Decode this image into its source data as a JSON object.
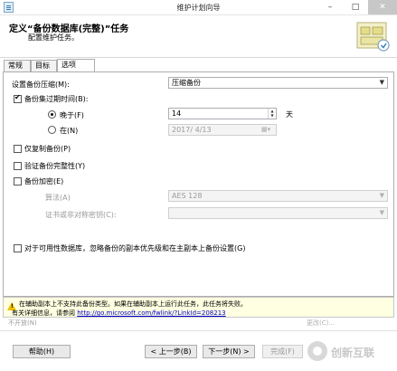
{
  "window": {
    "title": "维护计划向导",
    "min_glyph": "–",
    "max_glyph": "□",
    "close_glyph": "✕"
  },
  "header": {
    "title": "定义“备份数据库(完整)”任务",
    "subtitle": "配置维护任务。"
  },
  "tabs": [
    "常规",
    "目标",
    "选项"
  ],
  "active_tab": "选项",
  "options": {
    "compression_label": "设置备份压缩(M):",
    "compression_value": "压缩备份",
    "expire_label": "备份集过期时间(B):",
    "expire_checked": true,
    "after_label": "晚于(F)",
    "after_selected": true,
    "after_value": "14",
    "days_label": "天",
    "on_label": "在(N)",
    "on_value": "2017/ 4/13",
    "copy_only_label": "仅复制备份(P)",
    "verify_label": "验证备份完整性(Y)",
    "encrypt_label": "备份加密(E)",
    "algorithm_label": "算法(A)",
    "algorithm_value": "AES 128",
    "cert_label": "证书或非对称密钥(C):",
    "cert_value": "",
    "ag_label": "对于可用性数据库，忽略备份的副本优先级和在主副本上备份设置(G)"
  },
  "warning": {
    "line1": "在辅助副本上不支持此备份类型。如果在辅助副本上运行此任务，此任务将失败。",
    "line2_prefix": "有关详细信息，请参阅",
    "link": "http://go.microsoft.com/fwlink/?LinkId=208213"
  },
  "behind_row": {
    "left": "不开放(N)",
    "right": "更改(C)..."
  },
  "buttons": {
    "help": "帮助(H)",
    "back": "< 上一步(B)",
    "next": "下一步(N) >",
    "finish": "完成(F)"
  },
  "watermark": {
    "text": "创新互联"
  },
  "colors": {
    "warning_bg": "#ffffe1",
    "link": "#0000cc",
    "disabled_text": "#9a9a9a"
  }
}
